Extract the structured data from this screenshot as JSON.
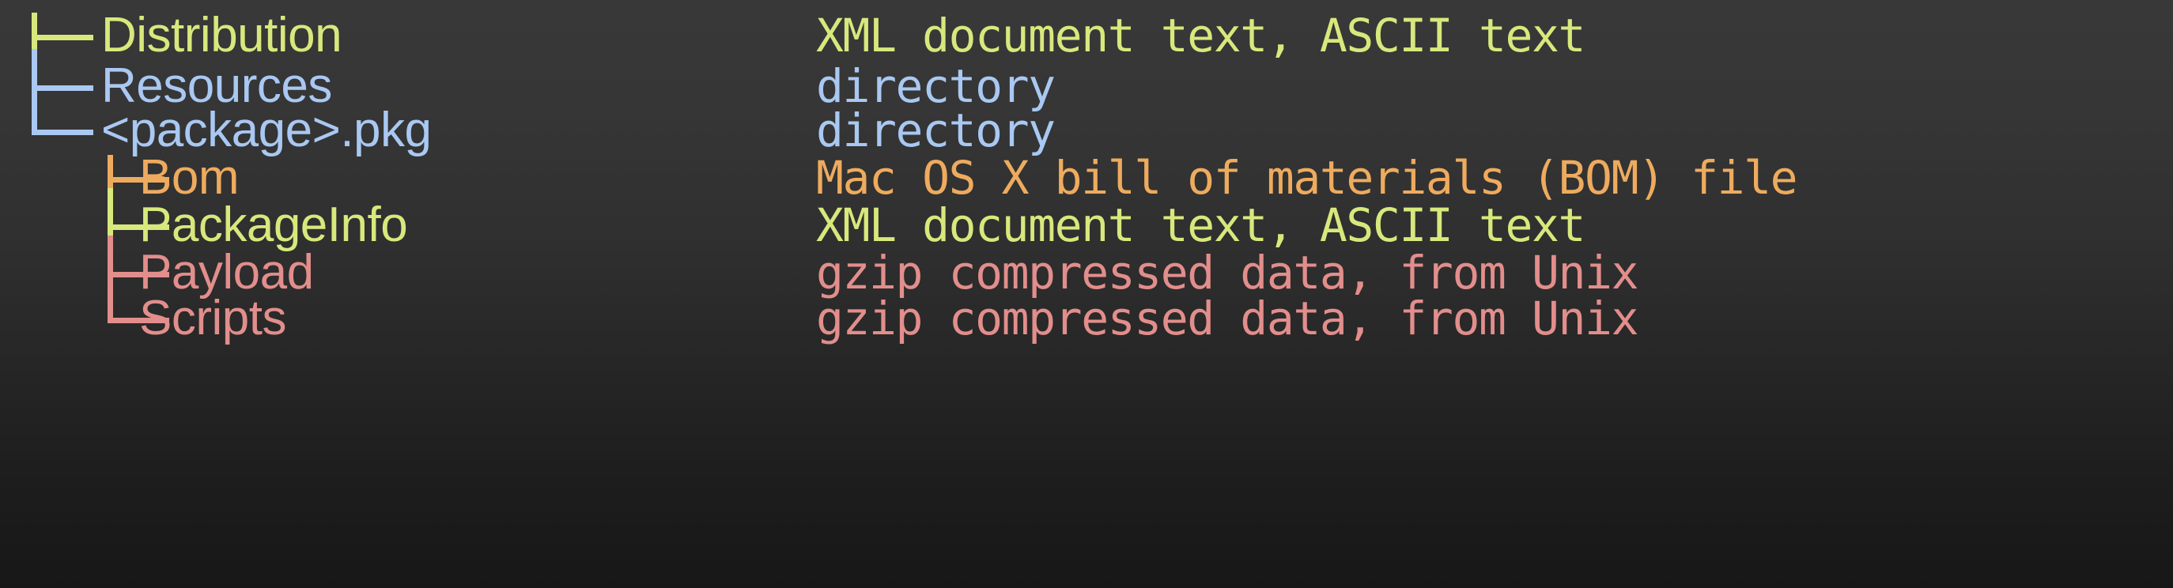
{
  "terminal": {
    "background_top": "#383838",
    "background_bottom": "#171717",
    "command_output_type": "tree-listing"
  },
  "columns": {
    "name_header": "",
    "description_header": ""
  },
  "tree": {
    "rows": [
      {
        "name": "Distribution",
        "description": "XML document text, ASCII text",
        "level": 1,
        "last": false,
        "color": "#d8e87c",
        "connector": "tee"
      },
      {
        "name": "Resources",
        "description": "directory",
        "level": 1,
        "last": false,
        "color": "#a9c8f2",
        "connector": "tee"
      },
      {
        "name": "<package>.pkg",
        "description": "directory",
        "level": 1,
        "last": true,
        "color": "#a9c8f2",
        "connector": "elbow"
      },
      {
        "name": "Bom",
        "description": "Mac OS X bill of materials (BOM) file",
        "level": 2,
        "last": false,
        "color": "#eeab5e",
        "connector": "tee"
      },
      {
        "name": "PackageInfo",
        "description": "XML document text, ASCII text",
        "level": 2,
        "last": false,
        "color": "#d8e87c",
        "connector": "tee"
      },
      {
        "name": "Payload",
        "description": "gzip compressed data, from Unix",
        "level": 2,
        "last": false,
        "color": "#e28e8c",
        "connector": "tee"
      },
      {
        "name": "Scripts",
        "description": "gzip compressed data, from Unix",
        "level": 2,
        "last": true,
        "color": "#e28e8c",
        "connector": "elbow"
      }
    ]
  }
}
